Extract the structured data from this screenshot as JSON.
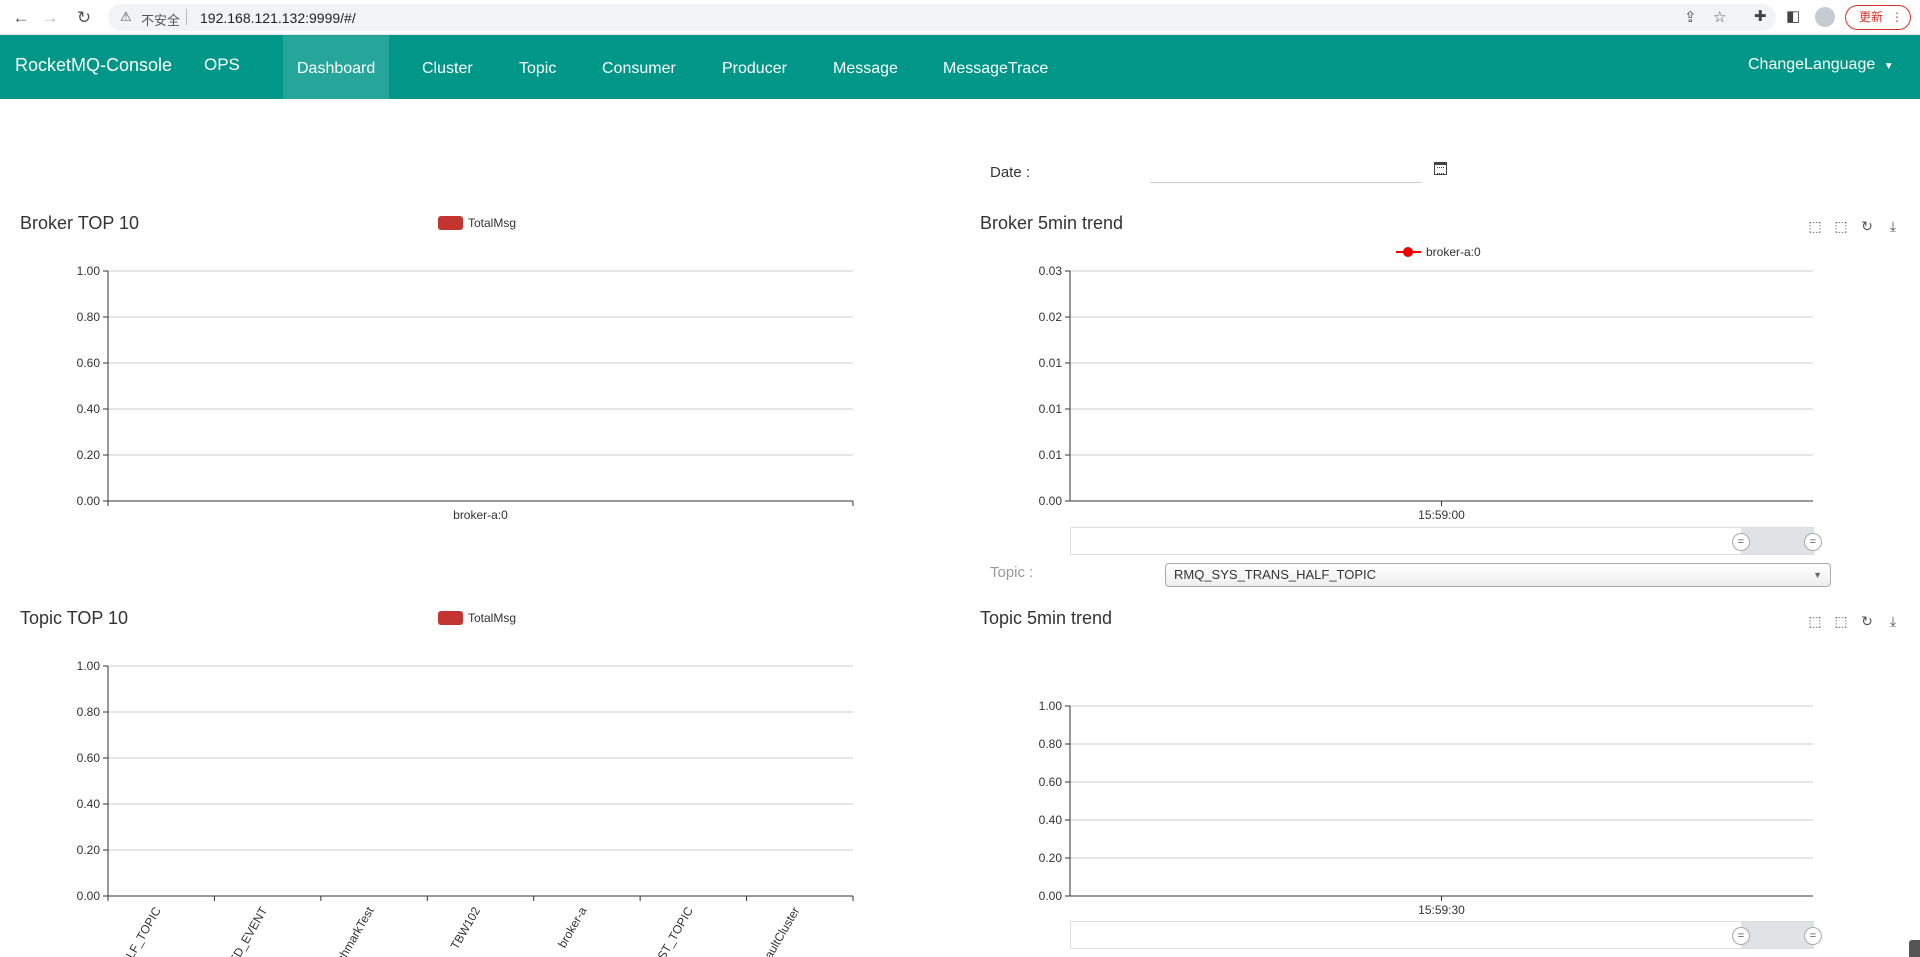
{
  "browser": {
    "back_icon": "arrow-left-icon",
    "insecure_label": "不安全",
    "url": "192.168.121.132:9999/#/",
    "update_label": "更新"
  },
  "navbar": {
    "brand": "RocketMQ-Console",
    "ops": "OPS",
    "items": [
      {
        "label": "Dashboard",
        "active": true
      },
      {
        "label": "Cluster"
      },
      {
        "label": "Topic"
      },
      {
        "label": "Consumer"
      },
      {
        "label": "Producer"
      },
      {
        "label": "Message"
      },
      {
        "label": "MessageTrace"
      }
    ],
    "language": "ChangeLanguage"
  },
  "date": {
    "label": "Date :",
    "value": ""
  },
  "topic_filter": {
    "label": "Topic :",
    "selected": "RMQ_SYS_TRANS_HALF_TOPIC"
  },
  "colors": {
    "primary": "#009688",
    "active": "#26a69a",
    "series": "#c23531",
    "trend": "#ee0000"
  },
  "chart_data": [
    {
      "type": "bar",
      "title": "Broker TOP 10",
      "legend": [
        "TotalMsg"
      ],
      "categories": [
        "broker-a:0"
      ],
      "series": [
        {
          "name": "TotalMsg",
          "values": [
            0
          ]
        }
      ],
      "yticks": [
        "0.00",
        "0.20",
        "0.40",
        "0.60",
        "0.80",
        "1.00"
      ],
      "ylim": [
        0,
        1
      ],
      "grid": true
    },
    {
      "type": "line",
      "title": "Broker 5min trend",
      "legend": [
        "broker-a:0"
      ],
      "x": [
        "15:59:00"
      ],
      "series": [
        {
          "name": "broker-a:0",
          "values": []
        }
      ],
      "yticks": [
        "0.00",
        "0.01",
        "0.01",
        "0.01",
        "0.02",
        "0.03"
      ],
      "ylim": [
        0,
        0.03
      ],
      "grid": true
    },
    {
      "type": "bar",
      "title": "Topic TOP 10",
      "legend": [
        "TotalMsg"
      ],
      "categories": [
        "ALF_TOPIC",
        "ED_EVENT",
        "chmarkTest",
        "TBW102",
        "broker-a",
        "EST_TOPIC",
        "aultCluster"
      ],
      "series": [
        {
          "name": "TotalMsg",
          "values": [
            0,
            0,
            0,
            0,
            0,
            0,
            0
          ]
        }
      ],
      "yticks": [
        "0.00",
        "0.20",
        "0.40",
        "0.60",
        "0.80",
        "1.00"
      ],
      "ylim": [
        0,
        1
      ],
      "grid": true
    },
    {
      "type": "line",
      "title": "Topic 5min trend",
      "legend": [],
      "x": [
        "15:59:30"
      ],
      "series": [],
      "yticks": [
        "0.00",
        "0.20",
        "0.40",
        "0.60",
        "0.80",
        "1.00"
      ],
      "ylim": [
        0,
        1
      ],
      "grid": true
    }
  ]
}
